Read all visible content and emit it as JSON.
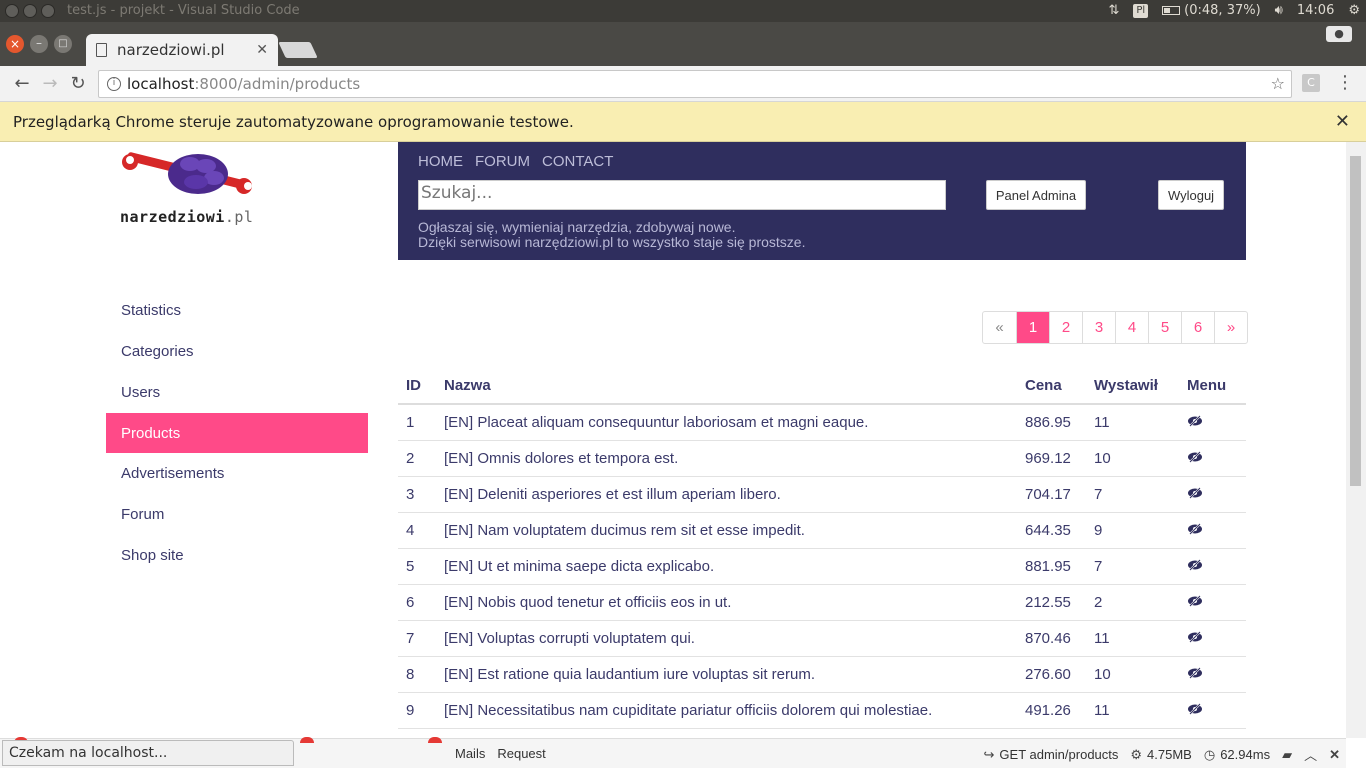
{
  "os": {
    "window_title": "test.js - projekt - Visual Studio Code",
    "keyboard": "Pl",
    "battery": "(0:48, 37%)",
    "clock": "14:06"
  },
  "browser": {
    "tab_title": "narzedziowi.pl",
    "url_host": "localhost",
    "url_path": ":8000/admin/products",
    "infobar_text": "Przeglądarką Chrome steruje zautomatyzowane oprogramowanie testowe."
  },
  "site": {
    "logo_text": "narzedziowi",
    "logo_tld": ".pl",
    "nav": [
      "HOME",
      "FORUM",
      "CONTACT"
    ],
    "search_placeholder": "Szukaj...",
    "admin_button": "Panel Admina",
    "logout_button": "Wyloguj",
    "tagline_line1": "Ogłaszaj się, wymieniaj narzędzia, zdobywaj nowe.",
    "tagline_line2": "Dzięki serwisowi narzędziowi.pl to wszystko staje się prostsze."
  },
  "sidebar": {
    "items": [
      {
        "label": "Statistics"
      },
      {
        "label": "Categories"
      },
      {
        "label": "Users"
      },
      {
        "label": "Products"
      },
      {
        "label": "Advertisements"
      },
      {
        "label": "Forum"
      },
      {
        "label": "Shop site"
      }
    ],
    "active": "Products"
  },
  "pagination": {
    "prev": "«",
    "pages": [
      "1",
      "2",
      "3",
      "4",
      "5",
      "6"
    ],
    "current": "1",
    "next": "»"
  },
  "table": {
    "headers": {
      "id": "ID",
      "name": "Nazwa",
      "price": "Cena",
      "by": "Wystawił",
      "menu": "Menu"
    },
    "rows": [
      {
        "id": "1",
        "name": "[EN] Placeat aliquam consequuntur laboriosam et magni eaque.",
        "price": "886.95",
        "by": "11"
      },
      {
        "id": "2",
        "name": "[EN] Omnis dolores et tempora est.",
        "price": "969.12",
        "by": "10"
      },
      {
        "id": "3",
        "name": "[EN] Deleniti asperiores et est illum aperiam libero.",
        "price": "704.17",
        "by": "7"
      },
      {
        "id": "4",
        "name": "[EN] Nam voluptatem ducimus rem sit et esse impedit.",
        "price": "644.35",
        "by": "9"
      },
      {
        "id": "5",
        "name": "[EN] Ut et minima saepe dicta explicabo.",
        "price": "881.95",
        "by": "7"
      },
      {
        "id": "6",
        "name": "[EN] Nobis quod tenetur et officiis eos in ut.",
        "price": "212.55",
        "by": "2"
      },
      {
        "id": "7",
        "name": "[EN] Voluptas corrupti voluptatem qui.",
        "price": "870.46",
        "by": "11"
      },
      {
        "id": "8",
        "name": "[EN] Est ratione quia laudantium iure voluptas sit rerum.",
        "price": "276.60",
        "by": "10"
      },
      {
        "id": "9",
        "name": "[EN] Necessitatibus nam cupiditate pariatur officiis dolorem qui molestiae.",
        "price": "491.26",
        "by": "11"
      }
    ]
  },
  "debugbar": {
    "status": "Czekam na localhost...",
    "tabs": [
      "Mails",
      "Request"
    ],
    "route": "GET admin/products",
    "memory": "4.75MB",
    "time": "62.94ms"
  }
}
